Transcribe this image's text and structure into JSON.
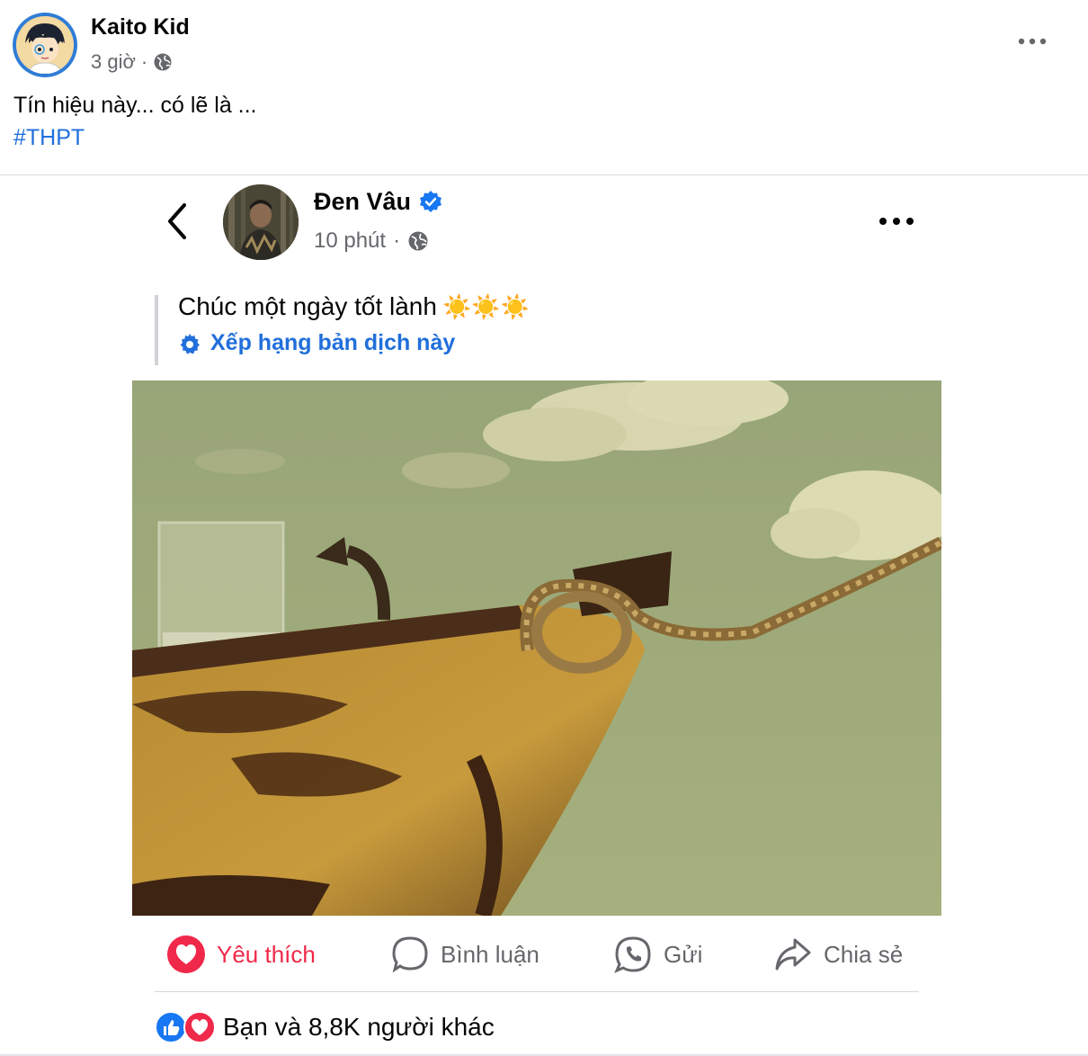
{
  "outer_post": {
    "author": "Kaito Kid",
    "time": "3 giờ",
    "text": "Tín hiệu này... có lẽ là ...",
    "hashtag": "#THPT"
  },
  "shared_post": {
    "author": "Đen Vâu",
    "time": "10 phút",
    "translated_text": "Chúc một ngày tốt lành",
    "emoji": "☀️☀️☀️",
    "rate_translation": "Xếp hạng bản dịch này"
  },
  "actions": {
    "like": "Yêu thích",
    "comment": "Bình luận",
    "send": "Gửi",
    "share": "Chia sẻ"
  },
  "reactions_summary": "Bạn và 8,8K người khác",
  "colors": {
    "accent_blue": "#216fdb",
    "like_red": "#f02849",
    "muted": "#65676b"
  }
}
